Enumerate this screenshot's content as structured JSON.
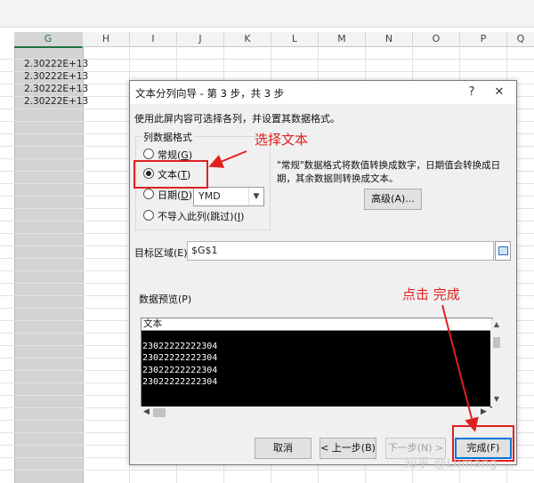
{
  "sheet": {
    "columns": [
      "G",
      "H",
      "I",
      "J",
      "K",
      "L",
      "M",
      "N",
      "O",
      "P",
      "Q"
    ],
    "selected_column": "G",
    "cells": [
      "2.30222E+13",
      "2.30222E+13",
      "2.30222E+13",
      "2.30222E+13"
    ]
  },
  "dialog": {
    "title": "文本分列向导 - 第 3 步，共 3 步",
    "help": "?",
    "close": "✕",
    "description": "使用此屏内容可选择各列，并设置其数据格式。",
    "format_group": {
      "label": "列数据格式",
      "options": [
        "常规(G)",
        "文本(T)",
        "日期(D):",
        "不导入此列(跳过)(I)"
      ],
      "option_general": "常规(",
      "option_general_key": "G",
      "option_general_end": ")",
      "option_text": "文本(",
      "option_text_key": "T",
      "option_text_end": ")",
      "option_date": "日期(",
      "option_date_key": "D",
      "option_date_end": "):",
      "option_skip": "不导入此列(跳过)(",
      "option_skip_key": "I",
      "option_skip_end": ")",
      "selected": "文本(T)",
      "date_format": "YMD"
    },
    "note": "\"常规\"数据格式将数值转换成数字，日期值会转换成日期，其余数据则转换成文本。",
    "advanced_button": "高级(A)...",
    "destination_label": "目标区域(E):",
    "destination_value": "$G$1",
    "preview_label": "数据预览(P)",
    "preview_header": "文本",
    "preview_rows": [
      "23022222222304",
      "23022222222304",
      "23022222222304",
      "23022222222304"
    ],
    "buttons": {
      "cancel": "取消",
      "back": "< 上一步(B)",
      "next": "下一步(N) >",
      "finish": "完成(F)"
    }
  },
  "annotations": {
    "select_text": "选择文本",
    "click_finish": "点击 完成",
    "color": "#e02020"
  },
  "watermark": "知乎 @Lumang"
}
